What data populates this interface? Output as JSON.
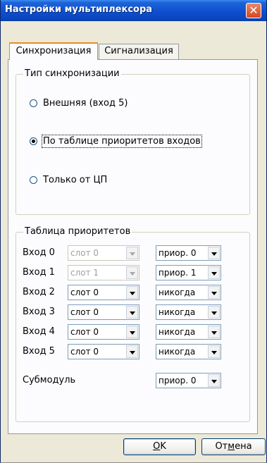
{
  "window": {
    "title": "Настройки мультиплексора",
    "close_glyph": "✕"
  },
  "tabs": [
    {
      "label": "Синхронизация",
      "active": true
    },
    {
      "label": "Сигнализация",
      "active": false
    }
  ],
  "sync_group": {
    "legend": "Тип синхронизации",
    "options": [
      {
        "label": "Внешняя (вход 5)",
        "checked": false
      },
      {
        "label": "По таблице приоритетов входов",
        "checked": true
      },
      {
        "label": "Только от ЦП",
        "checked": false
      }
    ]
  },
  "priority_group": {
    "legend": "Таблица приоритетов",
    "rows": [
      {
        "label": "Вход 0",
        "slot": "слот 0",
        "slot_enabled": false,
        "priority": "приор. 0"
      },
      {
        "label": "Вход 1",
        "slot": "слот 1",
        "slot_enabled": false,
        "priority": "приор. 1"
      },
      {
        "label": "Вход 2",
        "slot": "слот 0",
        "slot_enabled": true,
        "priority": "никогда"
      },
      {
        "label": "Вход 3",
        "slot": "слот 0",
        "slot_enabled": true,
        "priority": "никогда"
      },
      {
        "label": "Вход 4",
        "slot": "слот 0",
        "slot_enabled": true,
        "priority": "никогда"
      },
      {
        "label": "Вход 5",
        "slot": "слот 0",
        "slot_enabled": true,
        "priority": "никогда"
      }
    ],
    "submodule_label": "Субмодуль",
    "submodule_priority": "приор. 0"
  },
  "buttons": {
    "ok_mnemonic": "O",
    "ok_rest": "K",
    "cancel_pre": "От",
    "cancel_mnemonic": "м",
    "cancel_post": "ена"
  },
  "icons": {
    "close": "close-icon",
    "dropdown": "chevron-down-icon"
  }
}
